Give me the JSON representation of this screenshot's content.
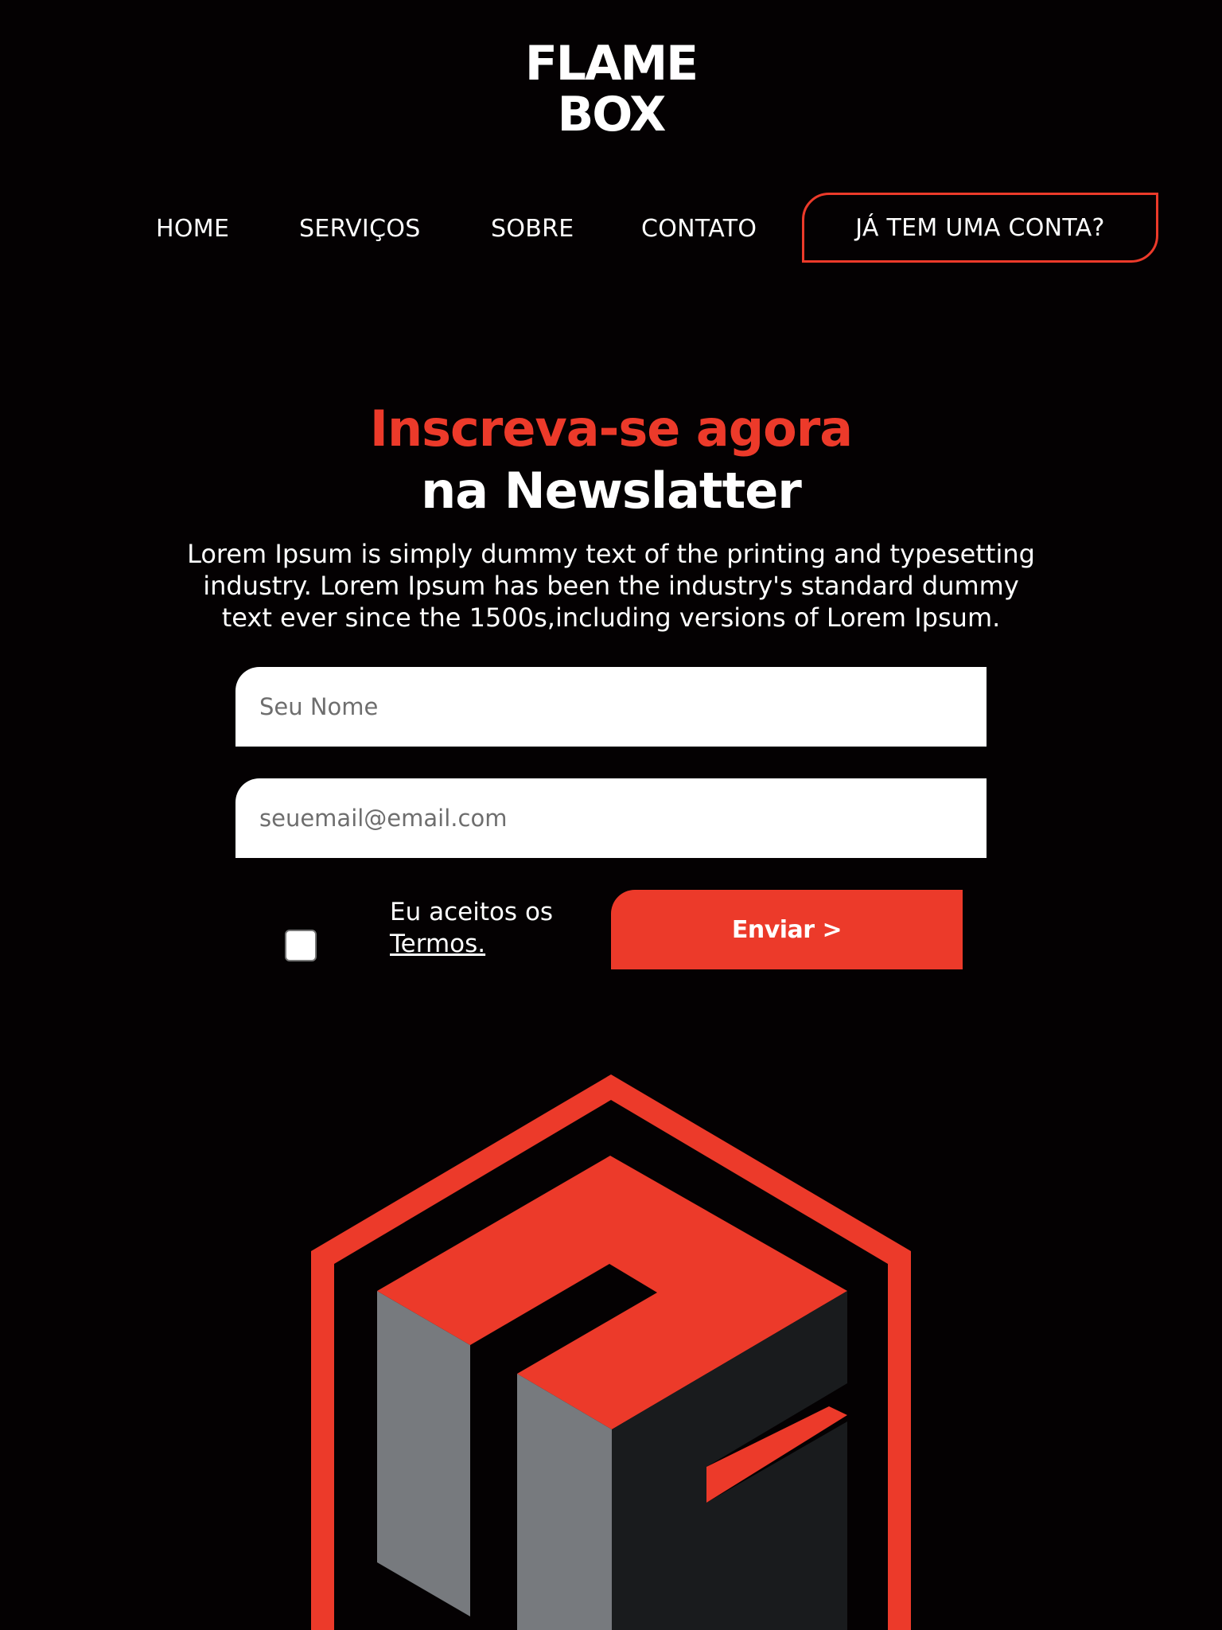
{
  "brand": {
    "line1": "FLAME",
    "line2": "BOX"
  },
  "nav": {
    "items": [
      {
        "label": "HOME"
      },
      {
        "label": "SERVIÇOS"
      },
      {
        "label": "SOBRE"
      },
      {
        "label": "CONTATO"
      }
    ],
    "cta_label": "JÁ TEM UMA CONTA?"
  },
  "newsletter": {
    "title_accent": "Inscreva-se agora",
    "title_main": "na Newslatter",
    "description": "Lorem Ipsum is simply dummy text of the printing and typesetting industry. Lorem Ipsum has been the industry's standard dummy text ever since the 1500s,including versions of Lorem Ipsum.",
    "name_placeholder": "Seu Nome",
    "email_placeholder": "seuemail@email.com",
    "terms_prefix": "Eu aceitos os",
    "terms_link": "Termos.",
    "submit_label": "Enviar >"
  },
  "colors": {
    "background": "#040102",
    "accent": "#ec3a2a",
    "text": "#ffffff",
    "emblem_light_grey": "#777a7e",
    "emblem_dark_grey": "#191b1d"
  }
}
